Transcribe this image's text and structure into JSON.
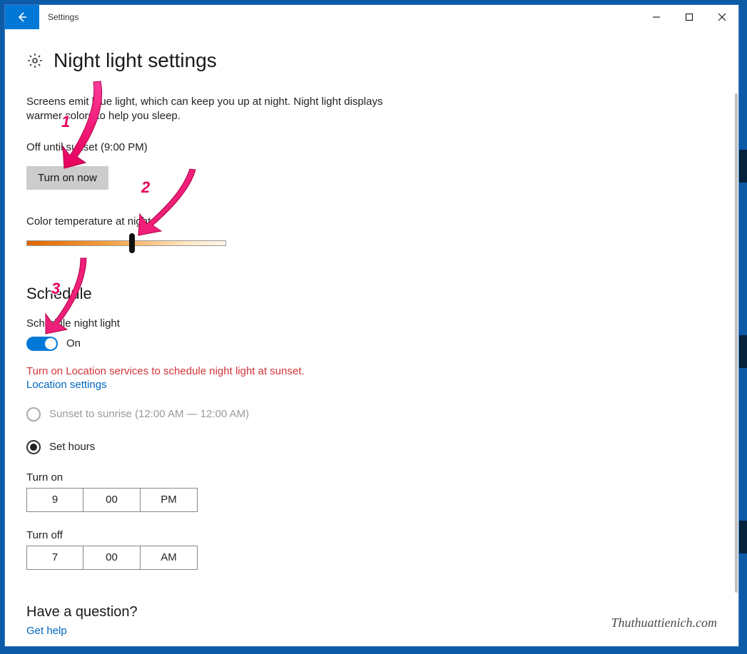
{
  "window": {
    "app_title": "Settings",
    "page_title": "Night light settings",
    "description": "Screens emit blue light, which can keep you up at night. Night light displays warmer colors to help you sleep.",
    "status": "Off until sunset (9:00 PM)",
    "turn_on_button": "Turn on now",
    "color_temp_label": "Color temperature at night",
    "slider_position_pct": 53,
    "schedule": {
      "heading": "Schedule",
      "toggle_label": "Schedule night light",
      "toggle_state": "On",
      "warning": "Turn on Location services to schedule night light at sunset.",
      "location_link": "Location settings",
      "option_sunset": "Sunset to sunrise (12:00 AM — 12:00 AM)",
      "option_sethours": "Set hours",
      "turn_on_label": "Turn on",
      "turn_on_hour": "9",
      "turn_on_min": "00",
      "turn_on_ampm": "PM",
      "turn_off_label": "Turn off",
      "turn_off_hour": "7",
      "turn_off_min": "00",
      "turn_off_ampm": "AM"
    },
    "help_heading": "Have a question?",
    "help_link": "Get help"
  },
  "annotations": {
    "n1": "1",
    "n2": "2",
    "n3": "3"
  },
  "watermark": "Thuthuattienich.com"
}
